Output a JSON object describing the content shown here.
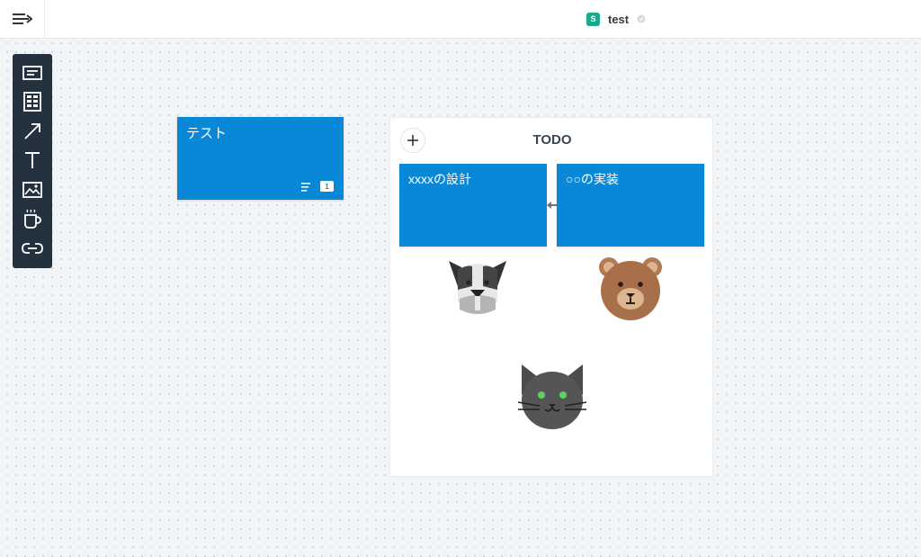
{
  "header": {
    "space_initial": "S",
    "board_title": "test"
  },
  "toolbar": {
    "tools": [
      "card-icon",
      "table-icon",
      "arrow-icon",
      "text-icon",
      "image-icon",
      "cup-icon",
      "link-icon"
    ]
  },
  "cards": {
    "test_card": {
      "text": "テスト",
      "comment_count": "1"
    }
  },
  "column": {
    "title": "TODO",
    "cards": [
      {
        "text": "xxxxの設計"
      },
      {
        "text": "○○の実装"
      }
    ],
    "images": [
      "dog-icon",
      "bear-icon",
      "cat-icon"
    ]
  },
  "colors": {
    "card_blue": "#0a88d8",
    "toolbar_bg": "#243240",
    "space_badge": "#19a98c"
  }
}
